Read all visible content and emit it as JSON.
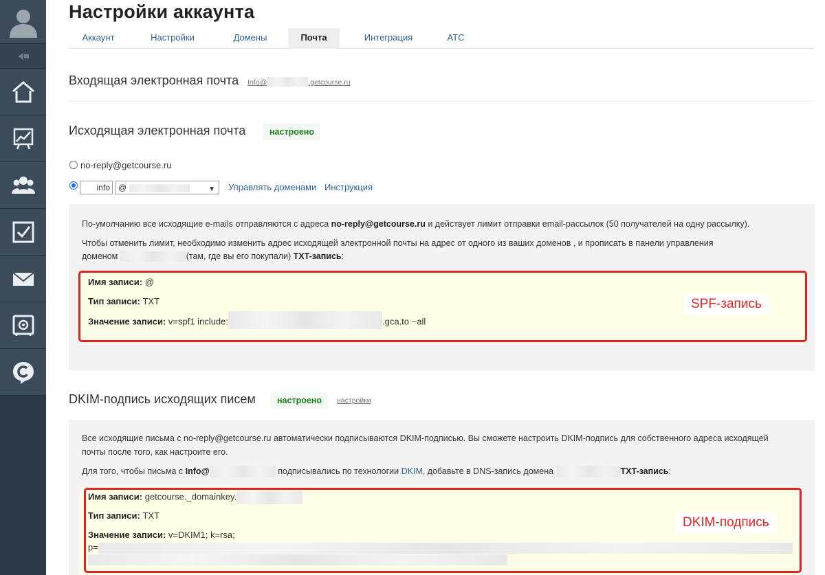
{
  "sidebar": {
    "icons": [
      "user-avatar-icon",
      "collapse-icon",
      "home-icon",
      "chart-icon",
      "users-icon",
      "tasks-icon",
      "mail-icon",
      "safe-icon",
      "getcourse-logo-icon"
    ]
  },
  "page": {
    "title": "Настройки аккаунта"
  },
  "tabs": [
    {
      "label": "Аккаунт",
      "active": false
    },
    {
      "label": "Настройки",
      "active": false
    },
    {
      "label": "Домены",
      "active": false
    },
    {
      "label": "Почта",
      "active": true
    },
    {
      "label": "Интеграция",
      "active": false
    },
    {
      "label": "АТС",
      "active": false
    }
  ],
  "incoming": {
    "title": "Входящая электронная почта",
    "email_prefix": "Info@",
    "email_suffix": ".getcourse.ru"
  },
  "outgoing": {
    "title": "Исходящая электронная почта",
    "status": "настроено",
    "option_default": "no-reply@getcourse.ru",
    "custom_local_part": "info",
    "custom_domain_prefix": "@",
    "manage_domains_link": "Управлять доменами",
    "instruction_link": "Инструкция",
    "info_p1_a": "По-умолчанию все исходящие e-mails отправляются с адреса ",
    "info_p1_bold": "no-reply@getcourse.ru",
    "info_p1_b": " и действует лимит отправки email-рассылок (50 получателей на одну рассылку).",
    "info_p2_line1": "Чтобы отменить лимит, необходимо изменить адрес исходящей электронной почты на адрес от одного из ваших доменов    , и прописать в панели управления",
    "info_p2_a": "доменом ",
    "info_p2_b": "(там, где вы его покупали) ",
    "info_p2_bold": "TXT-запись",
    "info_p2_c": ":",
    "record": {
      "name_label": "Имя записи:",
      "name_value": "@",
      "type_label": "Тип записи:",
      "type_value": "TXT",
      "value_label": "Значение записи:",
      "value_prefix": "v=spf1 include:",
      "value_suffix": ".gca.to ~all"
    },
    "annotation": "SPF-запись"
  },
  "dkim": {
    "title": "DKIM-подпись исходящих писем",
    "status": "настроено",
    "settings_link": "настройки",
    "info_p1_line1": "Все исходящие письма с no-reply@getcourse.ru автоматически подписываются DKIM-подписью. Вы сможете настроить DKIM-подпись для собственного адреса исходящей",
    "info_p1_line2": "почты после того, как настроите его.",
    "info_p2_a": "Для того, чтобы письма с ",
    "info_p2_bold": "Info@",
    "info_p2_b": "подписывались по технологии ",
    "info_p2_link": "DKIM",
    "info_p2_c": ", добавьте в DNS-запись домена ",
    "info_p2_bold2": "TXT-запись",
    "info_p2_d": ":",
    "record": {
      "name_label": "Имя записи:",
      "name_value": "getcourse._domainkey.",
      "type_label": "Тип записи:",
      "type_value": "TXT",
      "value_label": "Значение записи:",
      "value_value": "v=DKIM1; k=rsa;",
      "value_line2_prefix": "p="
    },
    "annotation": "DKIM-подпись"
  },
  "colors": {
    "accent": "#2f5f96",
    "status_green": "#1f7a1f",
    "annotation_red": "#e02424",
    "sidebar": "#2c3a47"
  }
}
